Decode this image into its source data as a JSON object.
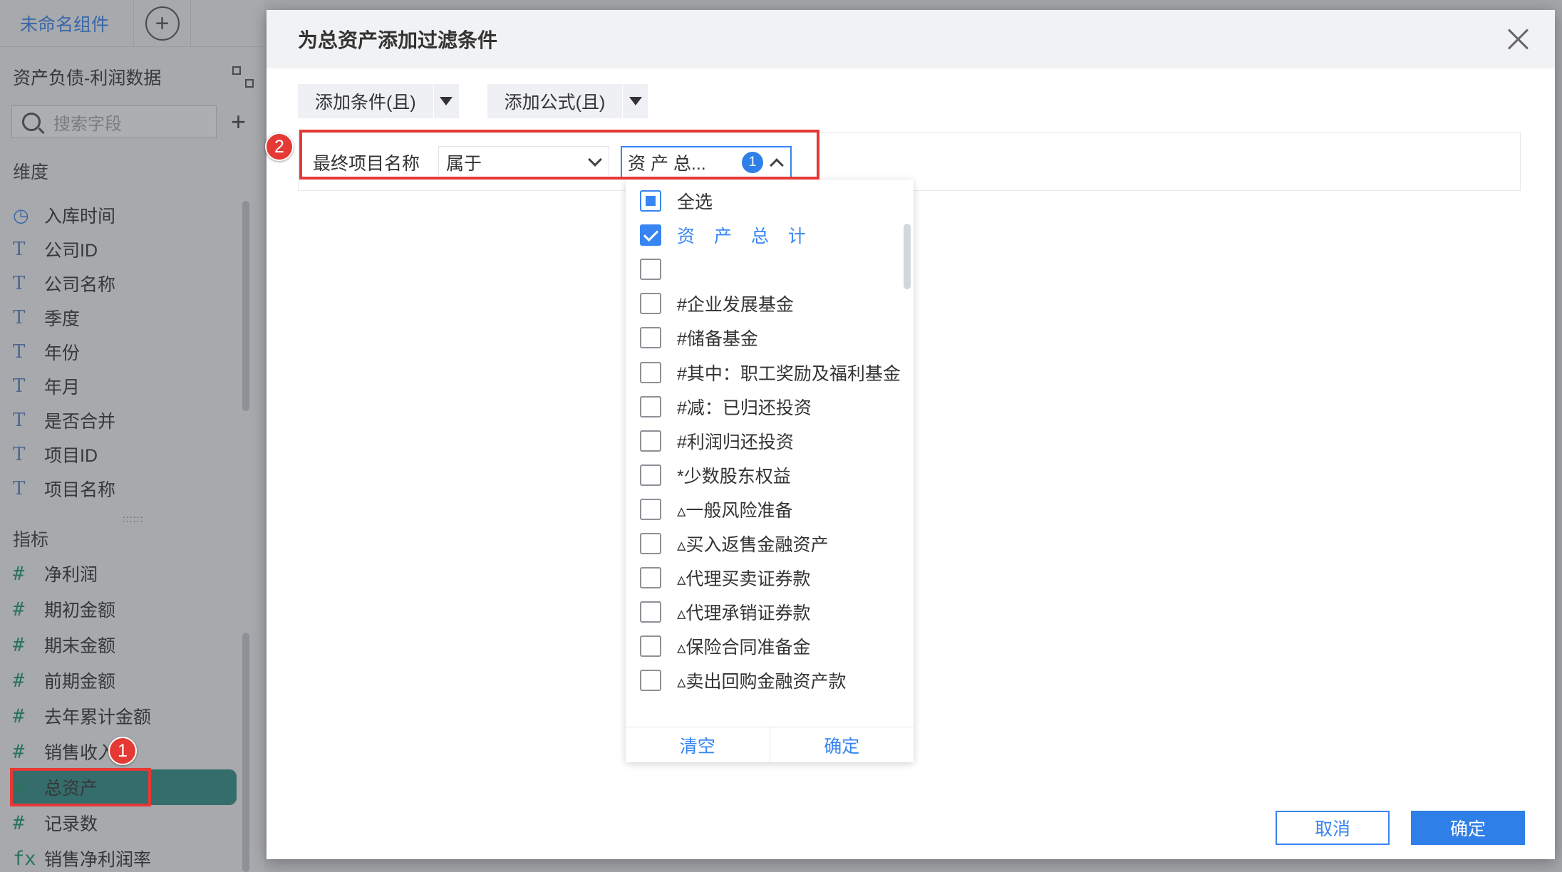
{
  "left_panel": {
    "tab_title": "未命名组件",
    "dataset_name": "资产负债-利润数据",
    "search_placeholder": "搜索字段",
    "dimensions_title": "维度",
    "dimensions": [
      {
        "icon": "clock-icon",
        "label": "入库时间"
      },
      {
        "icon": "text-type-icon",
        "label": "公司ID"
      },
      {
        "icon": "text-type-icon",
        "label": "公司名称"
      },
      {
        "icon": "text-type-icon",
        "label": "季度"
      },
      {
        "icon": "text-type-icon",
        "label": "年份"
      },
      {
        "icon": "text-type-icon",
        "label": "年月"
      },
      {
        "icon": "text-type-icon",
        "label": "是否合并"
      },
      {
        "icon": "text-type-icon",
        "label": "项目ID"
      },
      {
        "icon": "text-type-icon",
        "label": "项目名称"
      }
    ],
    "measures_title": "指标",
    "measures": [
      {
        "icon": "number-type-icon",
        "label": "净利润"
      },
      {
        "icon": "number-type-icon",
        "label": "期初金额"
      },
      {
        "icon": "number-type-icon",
        "label": "期末金额"
      },
      {
        "icon": "number-type-icon",
        "label": "前期金额"
      },
      {
        "icon": "number-type-icon",
        "label": "去年累计金额"
      },
      {
        "icon": "number-type-icon",
        "label": "销售收入"
      },
      {
        "icon": "number-type-icon",
        "label": "总资产"
      },
      {
        "icon": "number-type-icon",
        "label": "记录数"
      },
      {
        "icon": "formula-icon",
        "label": "销售净利润率"
      }
    ]
  },
  "markers": {
    "first": "1",
    "second": "2"
  },
  "dialog": {
    "title": "为总资产添加过滤条件",
    "add_condition_label": "添加条件(且)",
    "add_formula_label": "添加公式(且)",
    "condition": {
      "field_label": "最终项目名称",
      "operator": "属于",
      "value_display": "资 产 总...",
      "selected_count": "1"
    },
    "dropdown": {
      "options": [
        {
          "label": "全选",
          "state": "partial"
        },
        {
          "label": "资 产 总 计",
          "state": "checked"
        },
        {
          "label": "",
          "state": "unchecked"
        },
        {
          "label": "#企业发展基金",
          "state": "unchecked"
        },
        {
          "label": "#储备基金",
          "state": "unchecked"
        },
        {
          "label": "#其中：职工奖励及福利基金",
          "state": "unchecked"
        },
        {
          "label": "#减：已归还投资",
          "state": "unchecked"
        },
        {
          "label": "#利润归还投资",
          "state": "unchecked"
        },
        {
          "label": "*少数股东权益",
          "state": "unchecked"
        },
        {
          "label": "▵一般风险准备",
          "state": "unchecked"
        },
        {
          "label": "▵买入返售金融资产",
          "state": "unchecked"
        },
        {
          "label": "▵代理买卖证券款",
          "state": "unchecked"
        },
        {
          "label": "▵代理承销证券款",
          "state": "unchecked"
        },
        {
          "label": "▵保险合同准备金",
          "state": "unchecked"
        },
        {
          "label": "▵卖出回购金融资产款",
          "state": "unchecked"
        }
      ],
      "clear_label": "清空",
      "confirm_label": "确定"
    },
    "cancel_label": "取消",
    "ok_label": "确定"
  },
  "colors": {
    "accent": "#3685f2",
    "marker": "#e53935",
    "selected_row": "#2f8f8a"
  }
}
